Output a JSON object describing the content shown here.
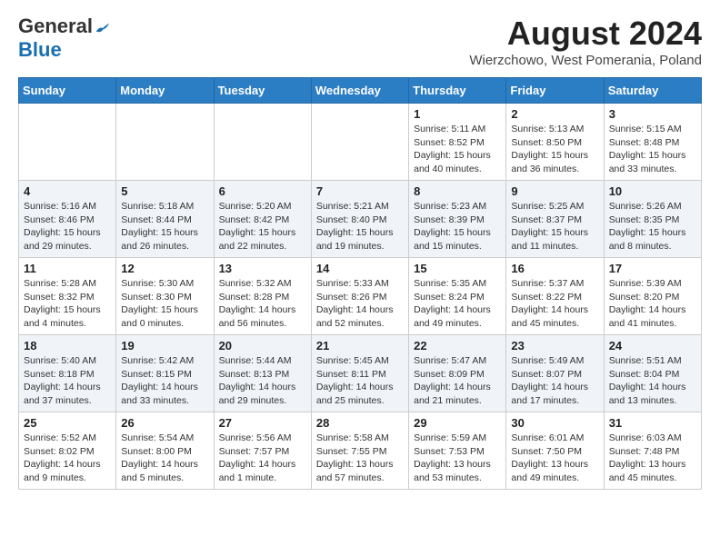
{
  "header": {
    "logo_general": "General",
    "logo_blue": "Blue",
    "month_title": "August 2024",
    "subtitle": "Wierzchowo, West Pomerania, Poland"
  },
  "weekdays": [
    "Sunday",
    "Monday",
    "Tuesday",
    "Wednesday",
    "Thursday",
    "Friday",
    "Saturday"
  ],
  "weeks": [
    [
      {
        "day": "",
        "info": ""
      },
      {
        "day": "",
        "info": ""
      },
      {
        "day": "",
        "info": ""
      },
      {
        "day": "",
        "info": ""
      },
      {
        "day": "1",
        "info": "Sunrise: 5:11 AM\nSunset: 8:52 PM\nDaylight: 15 hours and 40 minutes."
      },
      {
        "day": "2",
        "info": "Sunrise: 5:13 AM\nSunset: 8:50 PM\nDaylight: 15 hours and 36 minutes."
      },
      {
        "day": "3",
        "info": "Sunrise: 5:15 AM\nSunset: 8:48 PM\nDaylight: 15 hours and 33 minutes."
      }
    ],
    [
      {
        "day": "4",
        "info": "Sunrise: 5:16 AM\nSunset: 8:46 PM\nDaylight: 15 hours and 29 minutes."
      },
      {
        "day": "5",
        "info": "Sunrise: 5:18 AM\nSunset: 8:44 PM\nDaylight: 15 hours and 26 minutes."
      },
      {
        "day": "6",
        "info": "Sunrise: 5:20 AM\nSunset: 8:42 PM\nDaylight: 15 hours and 22 minutes."
      },
      {
        "day": "7",
        "info": "Sunrise: 5:21 AM\nSunset: 8:40 PM\nDaylight: 15 hours and 19 minutes."
      },
      {
        "day": "8",
        "info": "Sunrise: 5:23 AM\nSunset: 8:39 PM\nDaylight: 15 hours and 15 minutes."
      },
      {
        "day": "9",
        "info": "Sunrise: 5:25 AM\nSunset: 8:37 PM\nDaylight: 15 hours and 11 minutes."
      },
      {
        "day": "10",
        "info": "Sunrise: 5:26 AM\nSunset: 8:35 PM\nDaylight: 15 hours and 8 minutes."
      }
    ],
    [
      {
        "day": "11",
        "info": "Sunrise: 5:28 AM\nSunset: 8:32 PM\nDaylight: 15 hours and 4 minutes."
      },
      {
        "day": "12",
        "info": "Sunrise: 5:30 AM\nSunset: 8:30 PM\nDaylight: 15 hours and 0 minutes."
      },
      {
        "day": "13",
        "info": "Sunrise: 5:32 AM\nSunset: 8:28 PM\nDaylight: 14 hours and 56 minutes."
      },
      {
        "day": "14",
        "info": "Sunrise: 5:33 AM\nSunset: 8:26 PM\nDaylight: 14 hours and 52 minutes."
      },
      {
        "day": "15",
        "info": "Sunrise: 5:35 AM\nSunset: 8:24 PM\nDaylight: 14 hours and 49 minutes."
      },
      {
        "day": "16",
        "info": "Sunrise: 5:37 AM\nSunset: 8:22 PM\nDaylight: 14 hours and 45 minutes."
      },
      {
        "day": "17",
        "info": "Sunrise: 5:39 AM\nSunset: 8:20 PM\nDaylight: 14 hours and 41 minutes."
      }
    ],
    [
      {
        "day": "18",
        "info": "Sunrise: 5:40 AM\nSunset: 8:18 PM\nDaylight: 14 hours and 37 minutes."
      },
      {
        "day": "19",
        "info": "Sunrise: 5:42 AM\nSunset: 8:15 PM\nDaylight: 14 hours and 33 minutes."
      },
      {
        "day": "20",
        "info": "Sunrise: 5:44 AM\nSunset: 8:13 PM\nDaylight: 14 hours and 29 minutes."
      },
      {
        "day": "21",
        "info": "Sunrise: 5:45 AM\nSunset: 8:11 PM\nDaylight: 14 hours and 25 minutes."
      },
      {
        "day": "22",
        "info": "Sunrise: 5:47 AM\nSunset: 8:09 PM\nDaylight: 14 hours and 21 minutes."
      },
      {
        "day": "23",
        "info": "Sunrise: 5:49 AM\nSunset: 8:07 PM\nDaylight: 14 hours and 17 minutes."
      },
      {
        "day": "24",
        "info": "Sunrise: 5:51 AM\nSunset: 8:04 PM\nDaylight: 14 hours and 13 minutes."
      }
    ],
    [
      {
        "day": "25",
        "info": "Sunrise: 5:52 AM\nSunset: 8:02 PM\nDaylight: 14 hours and 9 minutes."
      },
      {
        "day": "26",
        "info": "Sunrise: 5:54 AM\nSunset: 8:00 PM\nDaylight: 14 hours and 5 minutes."
      },
      {
        "day": "27",
        "info": "Sunrise: 5:56 AM\nSunset: 7:57 PM\nDaylight: 14 hours and 1 minute."
      },
      {
        "day": "28",
        "info": "Sunrise: 5:58 AM\nSunset: 7:55 PM\nDaylight: 13 hours and 57 minutes."
      },
      {
        "day": "29",
        "info": "Sunrise: 5:59 AM\nSunset: 7:53 PM\nDaylight: 13 hours and 53 minutes."
      },
      {
        "day": "30",
        "info": "Sunrise: 6:01 AM\nSunset: 7:50 PM\nDaylight: 13 hours and 49 minutes."
      },
      {
        "day": "31",
        "info": "Sunrise: 6:03 AM\nSunset: 7:48 PM\nDaylight: 13 hours and 45 minutes."
      }
    ]
  ]
}
